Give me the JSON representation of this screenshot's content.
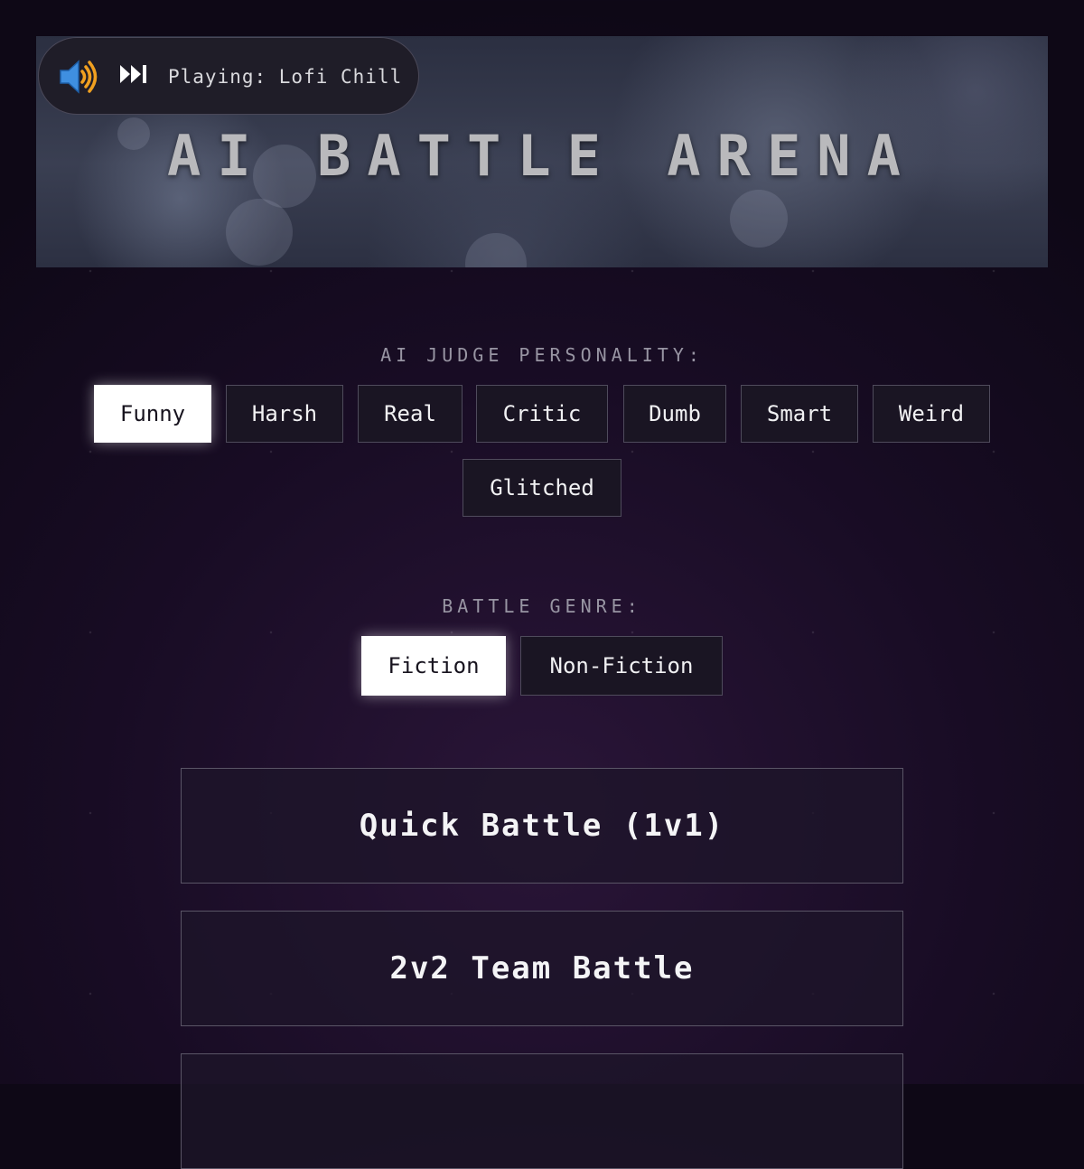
{
  "banner": {
    "title": "AI BATTLE ARENA"
  },
  "player": {
    "volume_icon": "speaker-volume-icon",
    "skip_icon": "skip-next-icon",
    "now_playing": "Playing: Lofi Chill"
  },
  "judge": {
    "label": "AI JUDGE PERSONALITY:",
    "options": [
      "Funny",
      "Harsh",
      "Real",
      "Critic",
      "Dumb",
      "Smart",
      "Weird",
      "Glitched"
    ],
    "selected": "Funny"
  },
  "genre": {
    "label": "BATTLE GENRE:",
    "options": [
      "Fiction",
      "Non-Fiction"
    ],
    "selected": "Fiction"
  },
  "modes": {
    "quick": "Quick Battle (1v1)",
    "team": "2v2 Team Battle",
    "third": ""
  },
  "colors": {
    "background": "#180c24",
    "selected_bg": "#ffffff",
    "speaker_blue": "#3f8fe0",
    "speaker_orange": "#f0a020"
  }
}
